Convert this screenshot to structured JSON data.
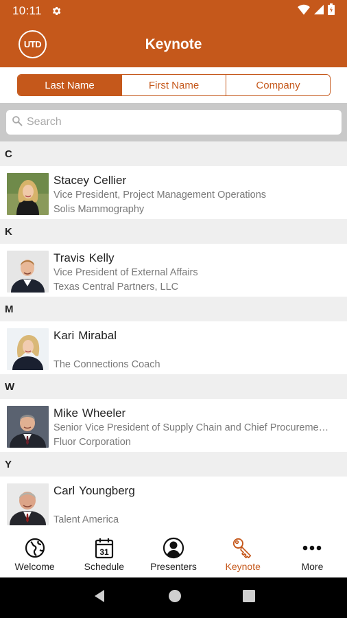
{
  "status_bar": {
    "time": "10:11"
  },
  "app": {
    "logo_text": "UTD",
    "title": "Keynote"
  },
  "segments": [
    {
      "label": "Last Name",
      "active": true
    },
    {
      "label": "First Name",
      "active": false
    },
    {
      "label": "Company",
      "active": false
    }
  ],
  "search": {
    "placeholder": "Search",
    "value": ""
  },
  "sections": [
    {
      "letter": "C",
      "people": [
        {
          "first": "Stacey",
          "last": "Cellier",
          "title": "Vice President, Project Management Operations",
          "company": "Solis Mammography",
          "photo_icon": "woman-blonde-photo"
        }
      ]
    },
    {
      "letter": "K",
      "people": [
        {
          "first": "Travis",
          "last": "Kelly",
          "title": "Vice President of External Affairs",
          "company": "Texas Central Partners, LLC",
          "photo_icon": "man-suit-photo"
        }
      ]
    },
    {
      "letter": "M",
      "people": [
        {
          "first": "Kari",
          "last": "Mirabal",
          "title": "",
          "company": "The Connections Coach",
          "photo_icon": "woman-photo"
        }
      ]
    },
    {
      "letter": "W",
      "people": [
        {
          "first": "Mike",
          "last": "Wheeler",
          "title": "Senior Vice President of Supply Chain and Chief Procureme…",
          "company": "Fluor Corporation",
          "photo_icon": "man-suit-photo"
        }
      ]
    },
    {
      "letter": "Y",
      "people": [
        {
          "first": "Carl",
          "last": "Youngberg",
          "title": "",
          "company": "Talent America",
          "photo_icon": "man-suit-photo"
        }
      ]
    }
  ],
  "tabs": [
    {
      "label": "Welcome",
      "icon": "globe-icon",
      "active": false
    },
    {
      "label": "Schedule",
      "icon": "calendar-icon",
      "icon_text": "31",
      "active": false
    },
    {
      "label": "Presenters",
      "icon": "person-icon",
      "active": false
    },
    {
      "label": "Keynote",
      "icon": "key-icon",
      "active": true
    },
    {
      "label": "More",
      "icon": "more-dots-icon",
      "active": false
    }
  ],
  "colors": {
    "brand": "#C5581B",
    "section_bg": "#efefef",
    "search_bg": "#c9c9c9",
    "subtext": "#7a7a7a"
  }
}
